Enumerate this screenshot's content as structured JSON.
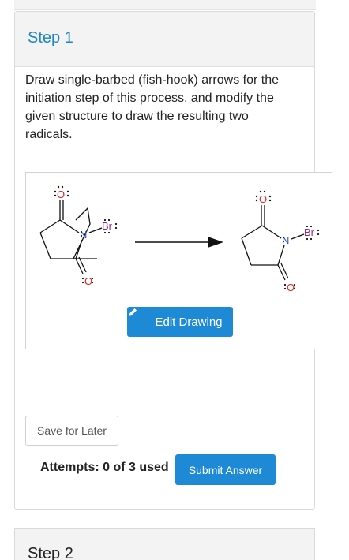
{
  "step": {
    "title": "Step 1",
    "instructions": "Draw single-barbed (fish-hook) arrows for the initiation step of this process, and modify the given structure to draw the resulting two radicals."
  },
  "drawing": {
    "left_molecule": {
      "top_oxygen": "O",
      "nitrogen": "N",
      "bromine": "Br",
      "bottom_oxygen": "O"
    },
    "right_molecule": {
      "top_oxygen": "O",
      "nitrogen": "N",
      "bromine": "Br",
      "bottom_oxygen": "O"
    },
    "edit_button_label": "Edit Drawing",
    "edit_icon": "pencil-icon"
  },
  "actions": {
    "save_label": "Save for Later",
    "attempts_text": "Attempts: 0 of 3 used",
    "submit_label": "Submit Answer"
  },
  "next_step": {
    "title": "Step 2"
  },
  "colors": {
    "accent": "#1e8ad6",
    "title_blue": "#1f86c8",
    "oxygen_red": "#d9261c",
    "nitrogen_blue": "#2a4fd4",
    "bromine_purple": "#8a2a8a"
  }
}
